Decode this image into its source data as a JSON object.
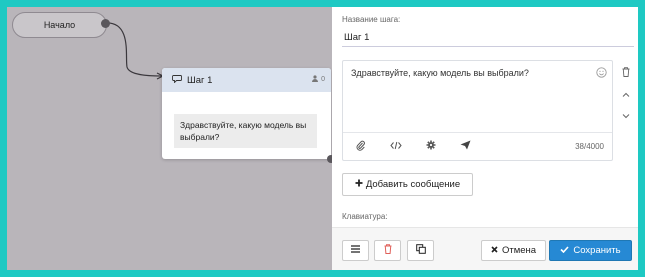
{
  "canvas": {
    "start_node_label": "Начало",
    "step_card": {
      "title": "Шаг 1",
      "user_count": "0",
      "message": "Здравствуйте, какую модель вы выбрали?"
    }
  },
  "panel": {
    "step_name_label": "Название шага:",
    "step_name_value": "Шаг 1",
    "message_text": "Здравствуйте, какую модель вы выбрали?",
    "char_count": "38/4000",
    "add_message_label": "Добавить сообщение",
    "keyboard_label": "Клавиатура:",
    "cancel_label": "Отмена",
    "save_label": "Сохранить"
  },
  "colors": {
    "outer_border": "#1ec9c3",
    "canvas_bg": "#b9b5ba",
    "save_button": "#2689d4",
    "delete_icon": "#e0605a",
    "card_header": "#dbe3ef"
  },
  "icons": {
    "card_header": [
      "chat-bubble-icon",
      "user-icon"
    ],
    "editor_side": [
      "trash-icon",
      "chevron-up-icon",
      "chevron-down-icon"
    ],
    "editor_toolbar": [
      "paperclip-icon",
      "code-icon",
      "gear-icon",
      "send-icon"
    ],
    "emoji": "smiley-icon",
    "bottom_bar": [
      "menu-icon",
      "trash-icon",
      "copy-icon",
      "close-icon",
      "check-icon"
    ]
  }
}
